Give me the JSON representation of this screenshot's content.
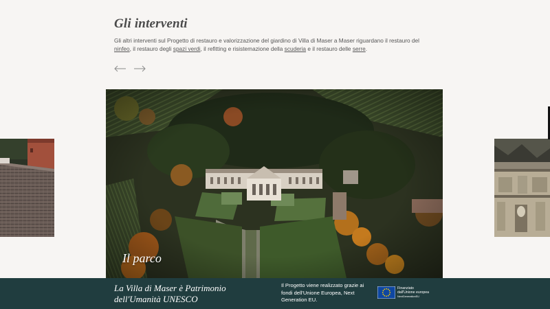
{
  "section": {
    "title": "Gli interventi",
    "intro_1": "Gli altri interventi sul Progetto di restauro e valorizzazione del giardino di Villa di Maser a Maser riguardano il restauro del ",
    "link_ninfeo": "ninfeo",
    "intro_2": ", il restauro degli ",
    "link_spazi_verdi": "spazi verdi",
    "intro_3": ", il refitting e risistemazione della ",
    "link_scuderia": "scuderia",
    "intro_4": " e il restauro delle ",
    "link_serre": "serre",
    "intro_5": "."
  },
  "carousel": {
    "prev_icon": "arrow-left-icon",
    "next_icon": "arrow-right-icon",
    "active_caption": "Il parco"
  },
  "footer": {
    "title": "La Villa di Maser è Patrimonio dell'Umanità UNESCO",
    "funding_text": "Il Progetto viene realizzato grazie ai fondi dell'Unione Europea, Next Generation EU.",
    "eu_line1": "Finanziato",
    "eu_line2": "dall'Unione europea",
    "eu_line3": "NextGenerationEU"
  },
  "colors": {
    "footer_bg": "#203d3f",
    "page_bg": "#f7f5f3",
    "eu_blue": "#0e47a1",
    "eu_gold": "#ffcc00"
  }
}
